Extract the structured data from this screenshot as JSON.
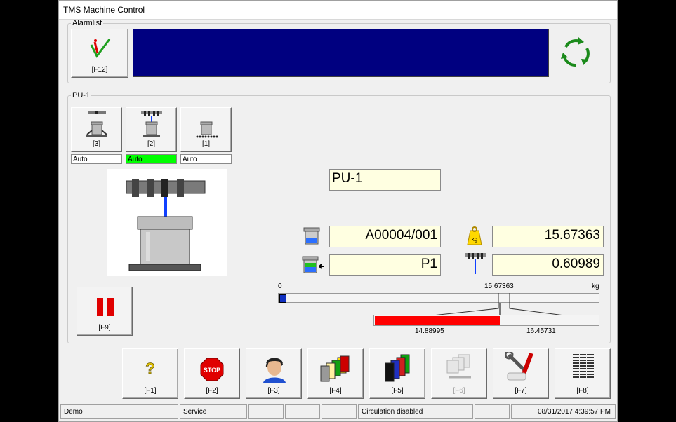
{
  "window": {
    "title": "TMS Machine Control"
  },
  "alarm": {
    "group_label": "Alarmlist",
    "ack_key": "[F12]",
    "bar_color": "#000080"
  },
  "pu": {
    "group_label": "PU-1",
    "stations": [
      {
        "key": "[3]",
        "mode": "Auto",
        "mode_color": "#ffffff"
      },
      {
        "key": "[2]",
        "mode": "Auto",
        "mode_color": "#00ff00"
      },
      {
        "key": "[1]",
        "mode": "Auto",
        "mode_color": "#ffffff"
      }
    ],
    "name": "PU-1",
    "order": "A00004/001",
    "weight": "15.67363",
    "program": "P1",
    "dose": "0.60989",
    "pause_key": "[F9]"
  },
  "scale": {
    "min": "0",
    "current": "15.67363",
    "unit": "kg",
    "lower_tol": "14.88995",
    "upper_tol": "16.45731",
    "progress_fraction": 0.0,
    "tol_color": "#ff0000"
  },
  "function_keys": [
    {
      "label": "[F1]",
      "icon": "help-icon",
      "enabled": true
    },
    {
      "label": "[F2]",
      "icon": "stop-icon",
      "enabled": true
    },
    {
      "label": "[F3]",
      "icon": "operator-icon",
      "enabled": true
    },
    {
      "label": "[F4]",
      "icon": "colorants-icon",
      "enabled": true
    },
    {
      "label": "[F5]",
      "icon": "canisters-icon",
      "enabled": true
    },
    {
      "label": "[F6]",
      "icon": "circulation-icon",
      "enabled": false
    },
    {
      "label": "[F7]",
      "icon": "tools-icon",
      "enabled": true
    },
    {
      "label": "[F8]",
      "icon": "keypad-icon",
      "enabled": true
    }
  ],
  "statusbar": {
    "mode": "Demo",
    "user": "Service",
    "message": "Circulation disabled",
    "datetime": "08/31/2017 4:39:57 PM"
  }
}
